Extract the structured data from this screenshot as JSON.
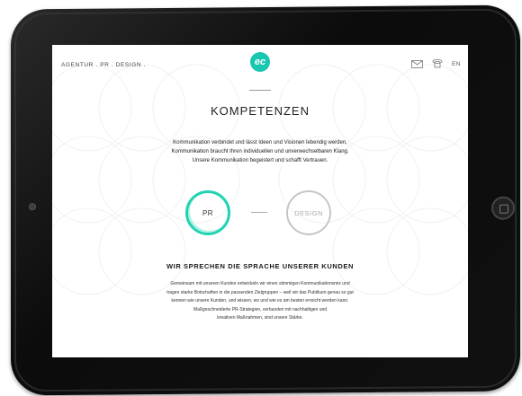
{
  "nav": {
    "left_label": "AGENTUR . PR . DESIGN .",
    "logo_text": "ec",
    "lang_label": "EN",
    "icons": [
      "mail-icon",
      "phone-icon"
    ]
  },
  "main": {
    "heading": "KOMPETENZEN",
    "intro_lines": [
      "Kommunikation verbindet und lässt Ideen und Visionen lebendig werden.",
      "Kommunikation braucht Ihren individuellen und unverwechselbaren Klang.",
      "Unsere Kommunikation begeistert und schafft Vertrauen."
    ],
    "circle_pr": "PR",
    "circle_design": "DESIGN",
    "subheading": "WIR SPRECHEN DIE SPRACHE UNSERER KUNDEN",
    "body_lines": [
      "Gemeinsam mit unseren Kunden entwickeln wir einen stimmigen Kommunikationsmix und",
      "tragen starke Botschaften in die passenden Zielgruppen – weil wir das Publikum genau so gut",
      "kennen wie unsere Kunden, und wissen, wo und wie es am besten erreicht werden kann.",
      "Maßgeschneiderte PR-Strategien, verbunden mit nachhaltigen und",
      "kreativen Maßnahmen, sind unsere Stärke."
    ]
  },
  "colors": {
    "accent": "#22d3b2",
    "logo": "#19c6b0",
    "inactive": "#c6c6c6"
  }
}
